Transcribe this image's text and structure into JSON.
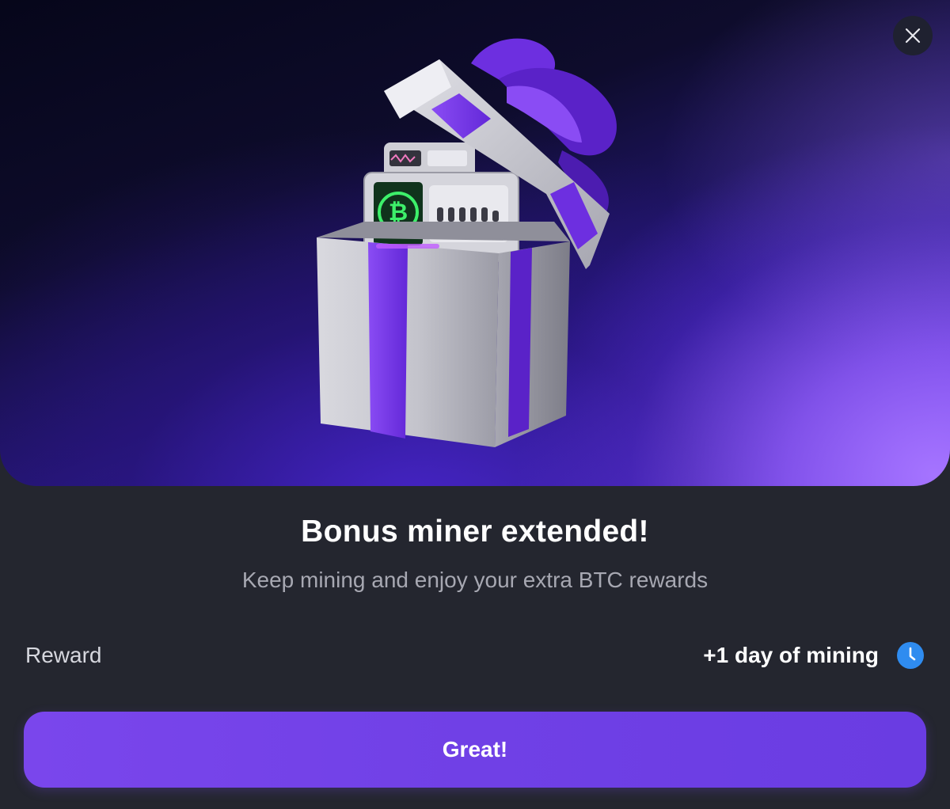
{
  "modal": {
    "title": "Bonus miner extended!",
    "subtitle": "Keep mining and enjoy your extra BTC rewards",
    "reward": {
      "label": "Reward",
      "value": "+1 day of mining",
      "icon": "clock-icon"
    },
    "primary_button": "Great!",
    "close_icon": "close-icon",
    "hero_image": "gift-box-with-miner"
  },
  "colors": {
    "accent": "#7544ea",
    "background": "#24262f",
    "clock_blue": "#2f8cf0",
    "ribbon": "#7a3cf0"
  }
}
